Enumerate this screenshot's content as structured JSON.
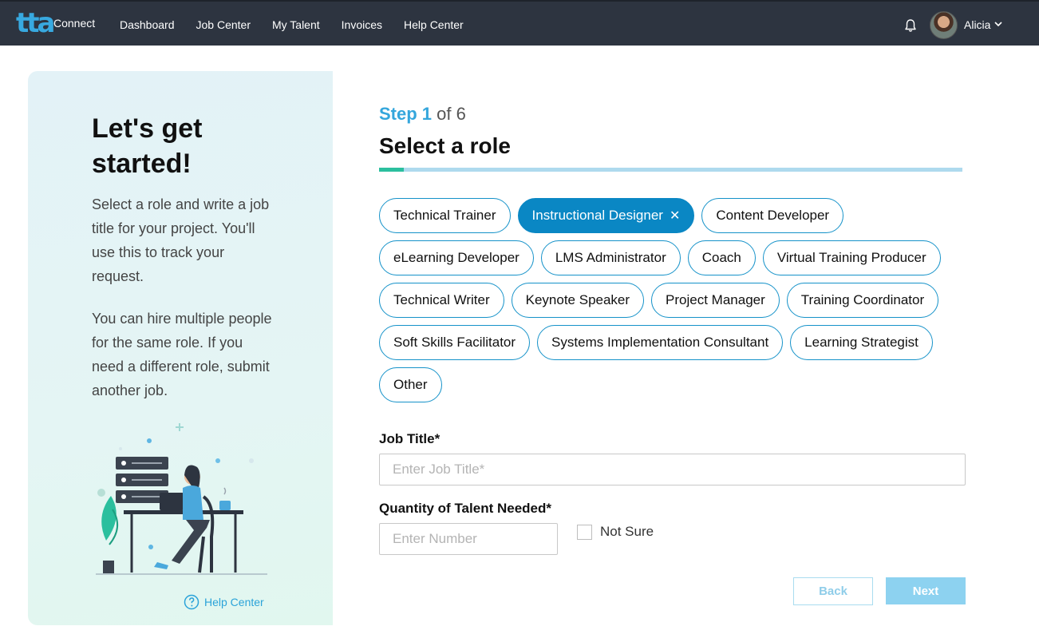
{
  "app": {
    "logo_text": "Connect"
  },
  "nav": {
    "items": [
      {
        "label": "Dashboard"
      },
      {
        "label": "Job Center"
      },
      {
        "label": "My Talent"
      },
      {
        "label": "Invoices"
      },
      {
        "label": "Help Center"
      }
    ],
    "user_name": "Alicia"
  },
  "sidebar": {
    "title": "Let's get started!",
    "paragraph1": "Select a role and write a job title for your project. You'll use this to track your request.",
    "paragraph2": "You can hire multiple people for the same role. If you need a different role, submit another job.",
    "help_link": "Help Center"
  },
  "step": {
    "current": "Step 1",
    "total": "of 6",
    "title": "Select a role",
    "progress_fraction": 0.043
  },
  "roles": [
    {
      "label": "Technical Trainer",
      "selected": false
    },
    {
      "label": "Instructional Designer",
      "selected": true
    },
    {
      "label": "Content Developer",
      "selected": false
    },
    {
      "label": "eLearning Developer",
      "selected": false
    },
    {
      "label": "LMS Administrator",
      "selected": false
    },
    {
      "label": "Coach",
      "selected": false
    },
    {
      "label": "Virtual Training Producer",
      "selected": false
    },
    {
      "label": "Technical Writer",
      "selected": false
    },
    {
      "label": "Keynote Speaker",
      "selected": false
    },
    {
      "label": "Project Manager",
      "selected": false
    },
    {
      "label": "Training Coordinator",
      "selected": false
    },
    {
      "label": "Soft Skills Facilitator",
      "selected": false
    },
    {
      "label": "Systems Implementation Consultant",
      "selected": false
    },
    {
      "label": "Learning Strategist",
      "selected": false
    },
    {
      "label": "Other",
      "selected": false
    }
  ],
  "form": {
    "job_title_label": "Job Title*",
    "job_title_placeholder": "Enter Job Title*",
    "job_title_value": "",
    "quantity_label": "Quantity of Talent Needed*",
    "quantity_placeholder": "Enter Number",
    "quantity_value": "",
    "not_sure_label": "Not Sure",
    "not_sure_checked": false
  },
  "buttons": {
    "back": "Back",
    "next": "Next"
  },
  "colors": {
    "nav_bg": "#2d3440",
    "accent": "#0a87c4",
    "step_accent": "#34a6dc",
    "progress_fill": "#2bbf9e"
  }
}
